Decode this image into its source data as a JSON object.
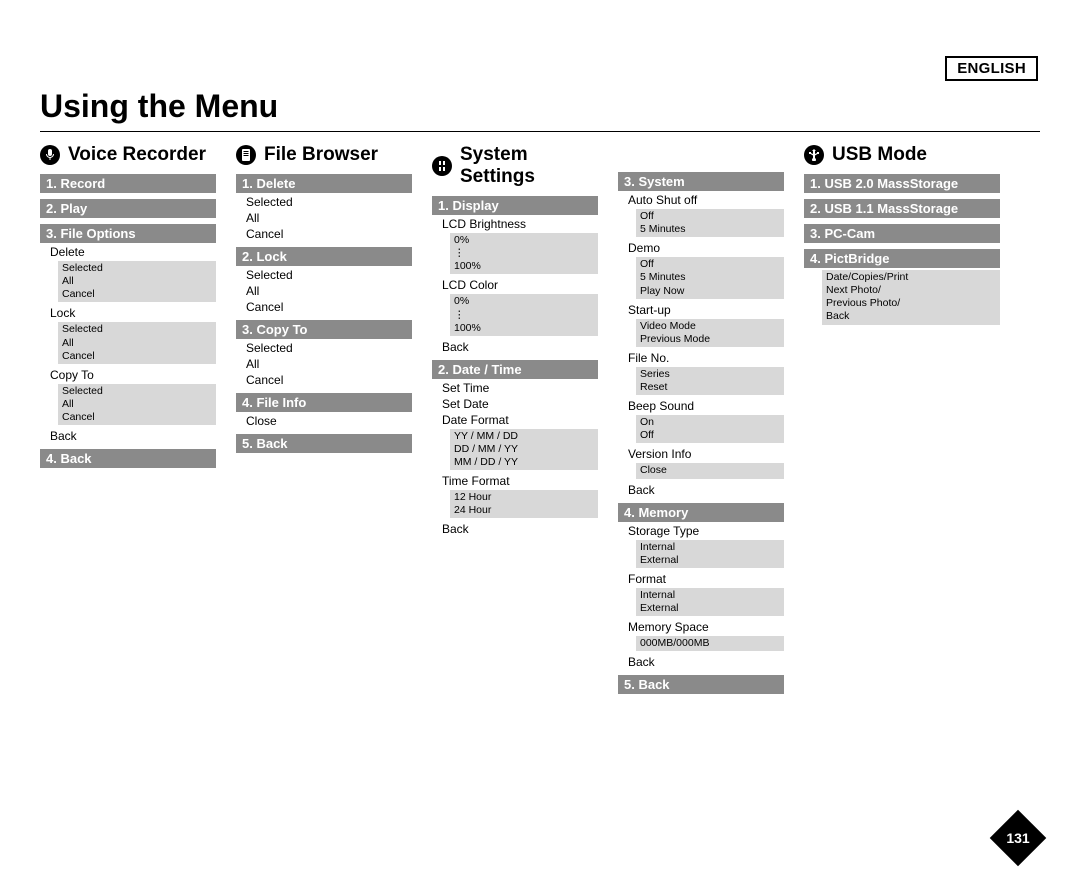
{
  "language": "ENGLISH",
  "title": "Using the Menu",
  "page_number": "131",
  "voice": {
    "heading": "Voice Recorder",
    "m1": "1. Record",
    "m2": "2. Play",
    "m3": "3. File Options",
    "m4": "4. Back",
    "fo": {
      "delete": "Delete",
      "lock": "Lock",
      "copyto": "Copy To",
      "back": "Back",
      "sub1": "Selected",
      "sub2": "All",
      "sub3": "Cancel"
    }
  },
  "filebrowser": {
    "heading": "File Browser",
    "m1": "1. Delete",
    "m2": "2. Lock",
    "m3": "3. Copy To",
    "m4": "4. File Info",
    "m5": "5. Back",
    "sub": {
      "selected": "Selected",
      "all": "All",
      "cancel": "Cancel",
      "close": "Close"
    }
  },
  "settings": {
    "heading": "System Settings",
    "display": {
      "bar": "1. Display",
      "lcdb": "LCD Brightness",
      "lcdc": "LCD Color",
      "range0": "0%",
      "rangedots": "⋮",
      "range100": "100%",
      "back": "Back"
    },
    "datetime": {
      "bar": "2. Date / Time",
      "settime": "Set Time",
      "setdate": "Set Date",
      "dateformat": "Date Format",
      "df1": "YY / MM / DD",
      "df2": "DD / MM / YY",
      "df3": "MM / DD / YY",
      "timeformat": "Time Format",
      "tf1": "12 Hour",
      "tf2": "24 Hour",
      "back": "Back"
    },
    "system": {
      "bar": "3. System",
      "autoshut": "Auto Shut off",
      "as1": "Off",
      "as2": "5 Minutes",
      "demo": "Demo",
      "d1": "Off",
      "d2": "5 Minutes",
      "d3": "Play Now",
      "startup": "Start-up",
      "su1": "Video Mode",
      "su2": "Previous Mode",
      "fileno": "File No.",
      "fn1": "Series",
      "fn2": "Reset",
      "beep": "Beep Sound",
      "b1": "On",
      "b2": "Off",
      "version": "Version Info",
      "v1": "Close",
      "back": "Back"
    },
    "memory": {
      "bar": "4. Memory",
      "storage": "Storage Type",
      "s1": "Internal",
      "s2": "External",
      "format": "Format",
      "f1": "Internal",
      "f2": "External",
      "memspace": "Memory Space",
      "ms1": "000MB/000MB",
      "back": "Back"
    },
    "back5": "5. Back"
  },
  "usb": {
    "heading": "USB Mode",
    "m1": "1. USB 2.0 MassStorage",
    "m2": "2. USB 1.1 MassStorage",
    "m3": "3. PC-Cam",
    "m4": "4. PictBridge",
    "pb1": "Date/Copies/Print",
    "pb2": "Next Photo/",
    "pb3": "Previous Photo/",
    "pb4": "Back"
  }
}
